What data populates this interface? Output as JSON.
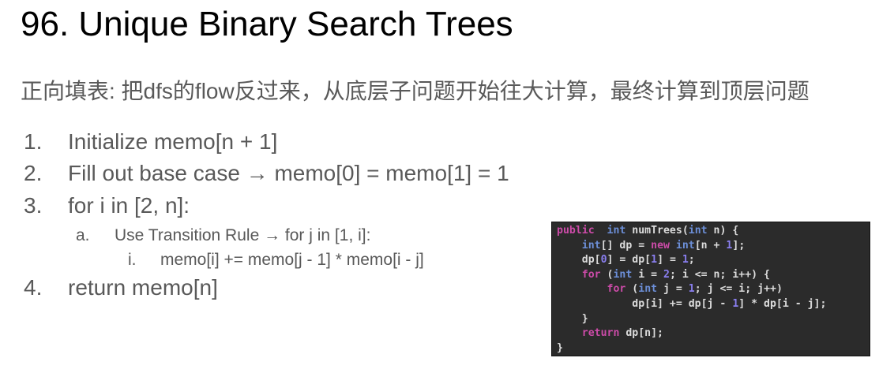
{
  "title": "96. Unique Binary Search Trees",
  "subtitle": "正向填表: 把dfs的flow反过来，从底层子问题开始往大计算，最终计算到顶层问题",
  "steps": [
    {
      "marker": "1.",
      "text": "Initialize memo[n + 1]"
    },
    {
      "marker": "2.",
      "text": "Fill out base case → memo[0] = memo[1] = 1"
    },
    {
      "marker": "3.",
      "text": "for i in [2, n]:"
    },
    {
      "marker": "a.",
      "text": "Use Transition Rule → for j in [1, i]:"
    },
    {
      "marker": "i.",
      "text": "memo[i] += memo[j - 1] * memo[i - j]"
    },
    {
      "marker": "4.",
      "text": "return memo[n]"
    }
  ],
  "code": {
    "lines": [
      [
        [
          "kw",
          "public"
        ],
        [
          "",
          "  "
        ],
        [
          "ty",
          "int"
        ],
        [
          "",
          " numTrees("
        ],
        [
          "ty",
          "int"
        ],
        [
          "",
          " n) {"
        ]
      ],
      [
        [
          "",
          "    "
        ],
        [
          "ty",
          "int"
        ],
        [
          "",
          "[] dp = "
        ],
        [
          "kw",
          "new"
        ],
        [
          "",
          ""
        ],
        [
          "ty",
          " int"
        ],
        [
          "",
          "[n + "
        ],
        [
          "nm",
          "1"
        ],
        [
          "",
          "];"
        ]
      ],
      [
        [
          "",
          "    dp["
        ],
        [
          "nm",
          "0"
        ],
        [
          "",
          "] = dp["
        ],
        [
          "nm",
          "1"
        ],
        [
          "",
          "] = "
        ],
        [
          "nm",
          "1"
        ],
        [
          "",
          ";"
        ]
      ],
      [
        [
          "",
          "    "
        ],
        [
          "kw",
          "for"
        ],
        [
          "",
          " ("
        ],
        [
          "ty",
          "int"
        ],
        [
          "",
          " i = "
        ],
        [
          "nm",
          "2"
        ],
        [
          "",
          "; i <= n; i++) {"
        ]
      ],
      [
        [
          "",
          "        "
        ],
        [
          "kw",
          "for"
        ],
        [
          "",
          " ("
        ],
        [
          "ty",
          "int"
        ],
        [
          "",
          " j = "
        ],
        [
          "nm",
          "1"
        ],
        [
          "",
          "; j <= i; j++)"
        ]
      ],
      [
        [
          "",
          "            dp[i] += dp[j - "
        ],
        [
          "nm",
          "1"
        ],
        [
          "",
          "] * dp[i - j];"
        ]
      ],
      [
        [
          "",
          "    }"
        ]
      ],
      [
        [
          "",
          "    "
        ],
        [
          "kw",
          "return"
        ],
        [
          "",
          " dp[n];"
        ]
      ],
      [
        [
          "",
          "}"
        ]
      ]
    ],
    "colors": {
      "background": "#2b2b2b",
      "keyword": "#cc4ba8",
      "type": "#6c8fd8",
      "number": "#8a7ff0",
      "text": "#dcdcdc"
    }
  }
}
